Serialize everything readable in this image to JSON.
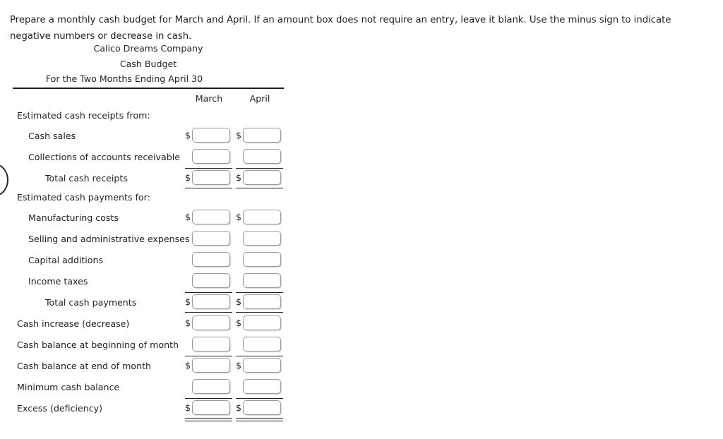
{
  "instructions": {
    "text": "Prepare a monthly cash budget for March and April. If an amount box does not require an entry, leave it blank. Use the minus sign to indicate negative numbers or decrease in cash."
  },
  "statement": {
    "company": "Calico Dreams Company",
    "title": "Cash Budget",
    "period": "For the Two Months Ending April 30",
    "columns": [
      {
        "label": "March",
        "key": "march"
      },
      {
        "label": "April",
        "key": "april"
      }
    ],
    "currency_symbol": "$",
    "rows": [
      {
        "label": "Estimated cash receipts from:",
        "indent": 0,
        "type": "section-header",
        "dollar": false,
        "rule_top": false,
        "rule_bottom": false,
        "march": "",
        "april": ""
      },
      {
        "label": "Cash sales",
        "indent": 1,
        "type": "input",
        "dollar": true,
        "rule_top": false,
        "rule_bottom": false,
        "march": "",
        "april": ""
      },
      {
        "label": "Collections of accounts receivable",
        "indent": 1,
        "type": "input",
        "dollar": false,
        "rule_top": false,
        "rule_bottom": false,
        "march": "",
        "april": ""
      },
      {
        "label": "Total cash receipts",
        "indent": 2,
        "type": "input",
        "dollar": true,
        "rule_top": true,
        "rule_bottom": true,
        "march": "",
        "april": ""
      },
      {
        "label": "Estimated cash payments for:",
        "indent": 0,
        "type": "section-header",
        "dollar": false,
        "rule_top": false,
        "rule_bottom": false,
        "march": "",
        "april": ""
      },
      {
        "label": "Manufacturing costs",
        "indent": 1,
        "type": "input",
        "dollar": true,
        "rule_top": false,
        "rule_bottom": false,
        "march": "",
        "april": ""
      },
      {
        "label": "Selling and administrative expenses",
        "indent": 1,
        "type": "input",
        "dollar": false,
        "rule_top": false,
        "rule_bottom": false,
        "march": "",
        "april": ""
      },
      {
        "label": "Capital additions",
        "indent": 1,
        "type": "input",
        "dollar": false,
        "rule_top": false,
        "rule_bottom": false,
        "march": "",
        "april": ""
      },
      {
        "label": "Income taxes",
        "indent": 1,
        "type": "input",
        "dollar": false,
        "rule_top": false,
        "rule_bottom": false,
        "march": "",
        "april": ""
      },
      {
        "label": "Total cash payments",
        "indent": 2,
        "type": "input",
        "dollar": true,
        "rule_top": true,
        "rule_bottom": true,
        "march": "",
        "april": ""
      },
      {
        "label": "Cash increase (decrease)",
        "indent": 0,
        "type": "input",
        "dollar": true,
        "rule_top": false,
        "rule_bottom": false,
        "march": "",
        "april": ""
      },
      {
        "label": "Cash balance at beginning of month",
        "indent": 0,
        "type": "input",
        "dollar": false,
        "rule_top": false,
        "rule_bottom": false,
        "march": "",
        "april": ""
      },
      {
        "label": "Cash balance at end of month",
        "indent": 0,
        "type": "input",
        "dollar": true,
        "rule_top": true,
        "rule_bottom": false,
        "march": "",
        "april": ""
      },
      {
        "label": "Minimum cash balance",
        "indent": 0,
        "type": "input",
        "dollar": false,
        "rule_top": false,
        "rule_bottom": false,
        "march": "",
        "april": ""
      },
      {
        "label": "Excess (deficiency)",
        "indent": 0,
        "type": "input",
        "dollar": true,
        "rule_top": true,
        "rule_bottom": "double",
        "march": "",
        "april": ""
      }
    ]
  }
}
